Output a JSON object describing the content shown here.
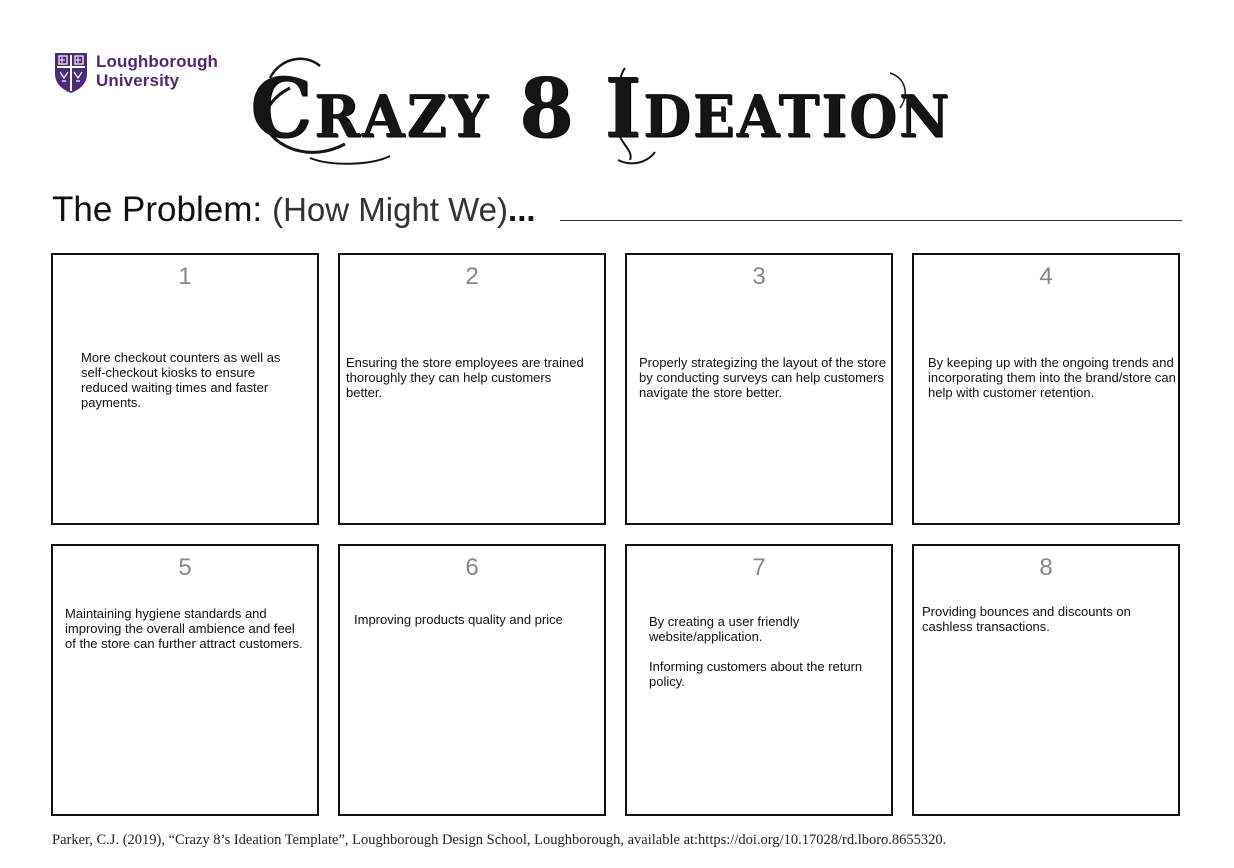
{
  "header": {
    "logo": {
      "line1": "Loughborough",
      "line2": "University",
      "shield_icon": "university-shield-icon",
      "brand_color": "#4b2a7a"
    },
    "title": "Crazy 8 Ideation"
  },
  "problem": {
    "label": "The Problem:",
    "subtitle": "(How Might We)",
    "ellipsis": "..."
  },
  "boxes": [
    {
      "number": "1",
      "lines": [
        "More checkout counters as well as self-checkout kiosks to ensure reduced waiting times and faster payments."
      ]
    },
    {
      "number": "2",
      "lines": [
        "Ensuring the store employees are trained thoroughly they can help customers better."
      ]
    },
    {
      "number": "3",
      "lines": [
        "Properly strategizing the layout of the store by conducting surveys can help customers navigate the store better."
      ]
    },
    {
      "number": "4",
      "lines": [
        "By keeping up with the ongoing trends and incorporating them into the brand/store can help with customer retention."
      ]
    },
    {
      "number": "5",
      "lines": [
        "Maintaining hygiene standards and improving the overall ambience and feel of the store can further attract customers."
      ]
    },
    {
      "number": "6",
      "lines": [
        "Improving products quality and price"
      ]
    },
    {
      "number": "7",
      "lines": [
        "By creating a user friendly website/application.",
        "Informing customers about the return policy."
      ]
    },
    {
      "number": "8",
      "lines": [
        "Providing bounces and discounts on cashless transactions."
      ]
    }
  ],
  "footer": {
    "citation": "Parker, C.J. (2019), “Crazy 8’s Ideation Template”, Loughborough Design School, Loughborough, available at:https://doi.org/10.17028/rd.lboro.8655320."
  }
}
